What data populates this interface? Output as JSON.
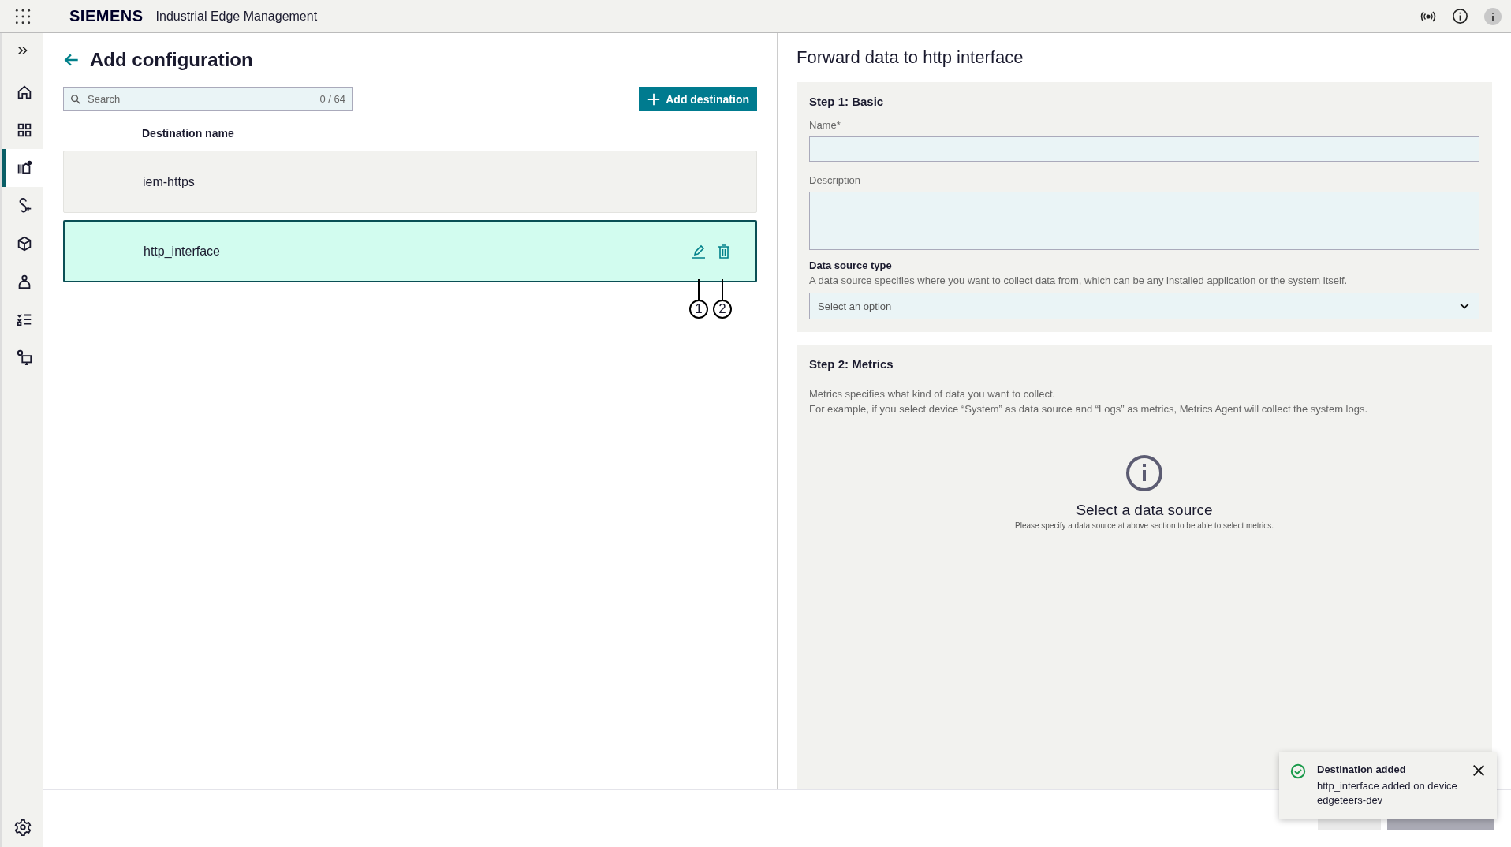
{
  "header": {
    "brand": "SIEMENS",
    "app_title": "Industrial Edge Management"
  },
  "sidebar": {
    "items": [
      {
        "selected": false
      },
      {
        "selected": false
      },
      {
        "selected": true
      },
      {
        "selected": false
      },
      {
        "selected": false
      },
      {
        "selected": false
      },
      {
        "selected": false
      },
      {
        "selected": false
      }
    ]
  },
  "left_panel": {
    "title": "Add configuration",
    "search": {
      "placeholder": "Search",
      "count": "0 / 64"
    },
    "add_button": "Add destination",
    "column_header": "Destination name",
    "rows": [
      {
        "name": "iem-https",
        "selected": false
      },
      {
        "name": "http_interface",
        "selected": true
      }
    ],
    "callouts": [
      "1",
      "2"
    ]
  },
  "right_panel": {
    "title": "Forward data to http  interface",
    "step1": {
      "title": "Step 1: Basic",
      "name_label": "Name*",
      "description_label": "Description",
      "source_label": "Data source type",
      "source_help": "A data source specifies where you want to collect data from, which can be any installed application or the system itself.",
      "source_placeholder": "Select an option"
    },
    "step2": {
      "title": "Step 2: Metrics",
      "lines": [
        "Metrics specifies what kind of data you want to collect.",
        "For example, if you select device “System” as data source and “Logs” as metrics, Metrics Agent will collect the system logs."
      ],
      "empty_title": "Select a data source",
      "empty_text": "Please specify a data source at above section to be able to select metrics."
    }
  },
  "toast": {
    "title": "Destination added",
    "message": "http_interface added on device edgeteers-dev"
  }
}
